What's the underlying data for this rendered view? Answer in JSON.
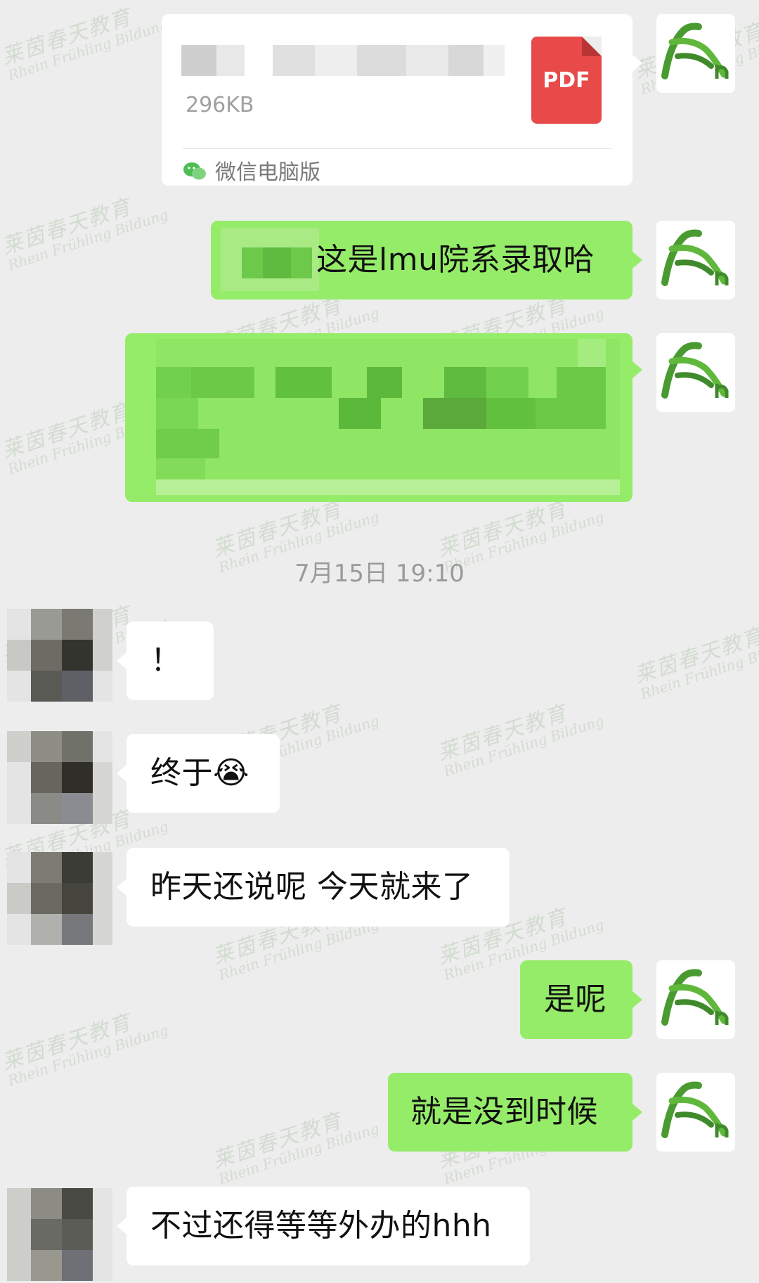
{
  "chat": {
    "file_message": {
      "size": "296KB",
      "type_badge": "PDF",
      "source": "微信电脑版"
    },
    "messages": [
      {
        "id": "m1",
        "side": "right",
        "text": "这是lmu院系录取哈"
      },
      {
        "id": "m2",
        "side": "right",
        "text": ""
      },
      {
        "id": "m3",
        "side": "left",
        "text": "！"
      },
      {
        "id": "m4",
        "side": "left",
        "text": "终于😭"
      },
      {
        "id": "m5",
        "side": "left",
        "text": "昨天还说呢 今天就来了"
      },
      {
        "id": "m6",
        "side": "right",
        "text": "是呢"
      },
      {
        "id": "m7",
        "side": "right",
        "text": "就是没到时候"
      },
      {
        "id": "m8",
        "side": "left",
        "text": "不过还得等等外办的hhh"
      }
    ],
    "timestamp": "7月15日 19:10"
  },
  "watermark": {
    "text": "莱茵春天教育",
    "subtext": "Rhein Frühling Bildung"
  },
  "colors": {
    "background": "#ededed",
    "sent_bubble": "#95ec69",
    "received_bubble": "#ffffff",
    "pdf_badge": "#e84a4a"
  },
  "icons": [
    "pdf-icon",
    "wechat-icon",
    "logo-avatar"
  ]
}
